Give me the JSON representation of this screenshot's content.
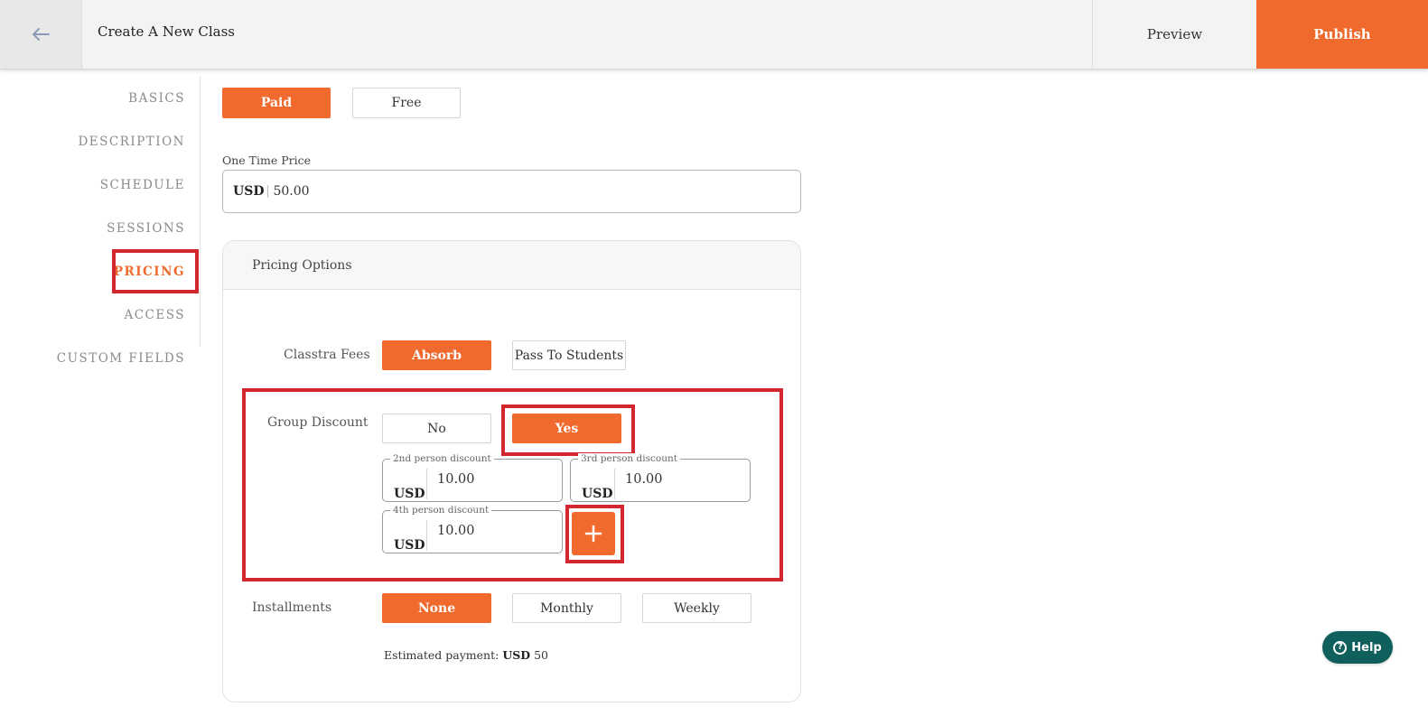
{
  "header": {
    "back_icon": "arrow-left-icon",
    "title": "Create A New Class",
    "preview_label": "Preview",
    "publish_label": "Publish"
  },
  "sidebar": {
    "items": [
      {
        "label": "BASICS",
        "active": false
      },
      {
        "label": "DESCRIPTION",
        "active": false
      },
      {
        "label": "SCHEDULE",
        "active": false
      },
      {
        "label": "SESSIONS",
        "active": false
      },
      {
        "label": "PRICING",
        "active": true
      },
      {
        "label": "ACCESS",
        "active": false
      },
      {
        "label": "CUSTOM FIELDS",
        "active": false
      }
    ]
  },
  "pricing_type": {
    "paid_label": "Paid",
    "free_label": "Free",
    "selected": "Paid"
  },
  "one_time_price": {
    "label": "One Time Price",
    "currency": "USD",
    "value": "50.00"
  },
  "pricing_options": {
    "title": "Pricing Options",
    "classtra_fees": {
      "label": "Classtra Fees",
      "absorb_label": "Absorb",
      "pass_label": "Pass To Students",
      "selected": "Absorb"
    },
    "group_discount": {
      "label": "Group Discount",
      "no_label": "No",
      "yes_label": "Yes",
      "selected": "Yes",
      "discounts": [
        {
          "legend": "2nd person discount",
          "currency": "USD",
          "value": "10.00"
        },
        {
          "legend": "3rd person discount",
          "currency": "USD",
          "value": "10.00"
        },
        {
          "legend": "4th person discount",
          "currency": "USD",
          "value": "10.00"
        }
      ],
      "add_icon": "plus-icon"
    },
    "installments": {
      "label": "Installments",
      "none_label": "None",
      "monthly_label": "Monthly",
      "weekly_label": "Weekly",
      "selected": "None"
    },
    "estimated": {
      "prefix": "Estimated payment:",
      "currency": "USD",
      "amount": "50"
    }
  },
  "help": {
    "icon": "question-circle-icon",
    "label": "Help"
  },
  "colors": {
    "accent": "#f06a2e",
    "highlight": "#d3262f",
    "help_bg": "#0f5f5c"
  }
}
